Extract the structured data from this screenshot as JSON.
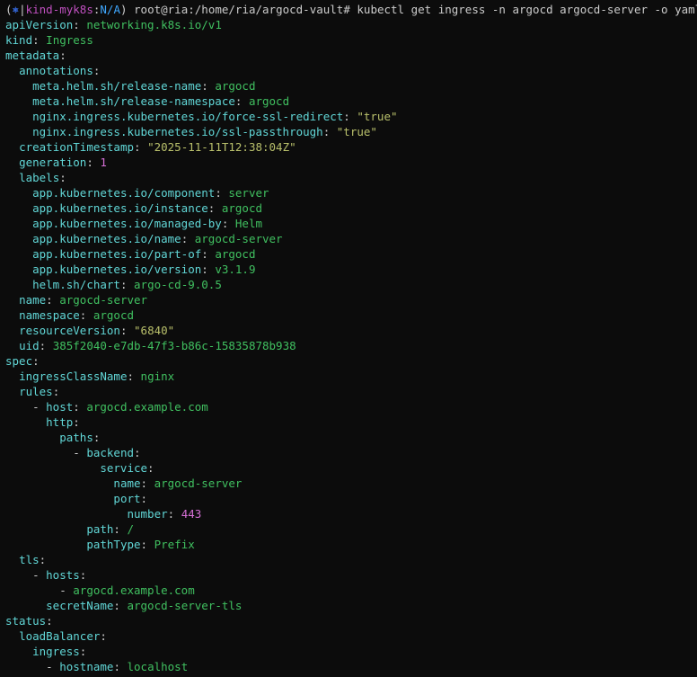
{
  "prompt": {
    "open_paren": "(",
    "k8s_symbol": "⎈",
    "separator": "|",
    "context": "kind-myk8s",
    "colon": ":",
    "namespace": "N/A",
    "close_paren": ")",
    "user_host_path": "root@ria:/home/ria/argocd-vault#",
    "command": "kubectl get ingress -n argocd argocd-server -o yaml | yq"
  },
  "lines": [
    {
      "indent": "",
      "key": "apiVersion",
      "sep": ": ",
      "value": "networking.k8s.io/v1",
      "type": "val"
    },
    {
      "indent": "",
      "key": "kind",
      "sep": ": ",
      "value": "Ingress",
      "type": "val"
    },
    {
      "indent": "",
      "key": "metadata",
      "sep": ":",
      "value": "",
      "type": "val"
    },
    {
      "indent": "  ",
      "key": "annotations",
      "sep": ":",
      "value": "",
      "type": "val"
    },
    {
      "indent": "    ",
      "key": "meta.helm.sh/release-name",
      "sep": ": ",
      "value": "argocd",
      "type": "val"
    },
    {
      "indent": "    ",
      "key": "meta.helm.sh/release-namespace",
      "sep": ": ",
      "value": "argocd",
      "type": "val"
    },
    {
      "indent": "    ",
      "key": "nginx.ingress.kubernetes.io/force-ssl-redirect",
      "sep": ": ",
      "value": "\"true\"",
      "type": "str"
    },
    {
      "indent": "    ",
      "key": "nginx.ingress.kubernetes.io/ssl-passthrough",
      "sep": ": ",
      "value": "\"true\"",
      "type": "str"
    },
    {
      "indent": "  ",
      "key": "creationTimestamp",
      "sep": ": ",
      "value": "\"2025-11-11T12:38:04Z\"",
      "type": "str"
    },
    {
      "indent": "  ",
      "key": "generation",
      "sep": ": ",
      "value": "1",
      "type": "num"
    },
    {
      "indent": "  ",
      "key": "labels",
      "sep": ":",
      "value": "",
      "type": "val"
    },
    {
      "indent": "    ",
      "key": "app.kubernetes.io/component",
      "sep": ": ",
      "value": "server",
      "type": "val"
    },
    {
      "indent": "    ",
      "key": "app.kubernetes.io/instance",
      "sep": ": ",
      "value": "argocd",
      "type": "val"
    },
    {
      "indent": "    ",
      "key": "app.kubernetes.io/managed-by",
      "sep": ": ",
      "value": "Helm",
      "type": "val"
    },
    {
      "indent": "    ",
      "key": "app.kubernetes.io/name",
      "sep": ": ",
      "value": "argocd-server",
      "type": "val"
    },
    {
      "indent": "    ",
      "key": "app.kubernetes.io/part-of",
      "sep": ": ",
      "value": "argocd",
      "type": "val"
    },
    {
      "indent": "    ",
      "key": "app.kubernetes.io/version",
      "sep": ": ",
      "value": "v3.1.9",
      "type": "val"
    },
    {
      "indent": "    ",
      "key": "helm.sh/chart",
      "sep": ": ",
      "value": "argo-cd-9.0.5",
      "type": "val"
    },
    {
      "indent": "  ",
      "key": "name",
      "sep": ": ",
      "value": "argocd-server",
      "type": "val"
    },
    {
      "indent": "  ",
      "key": "namespace",
      "sep": ": ",
      "value": "argocd",
      "type": "val"
    },
    {
      "indent": "  ",
      "key": "resourceVersion",
      "sep": ": ",
      "value": "\"6840\"",
      "type": "str"
    },
    {
      "indent": "  ",
      "key": "uid",
      "sep": ": ",
      "value": "385f2040-e7db-47f3-b86c-15835878b938",
      "type": "val"
    },
    {
      "indent": "",
      "key": "spec",
      "sep": ":",
      "value": "",
      "type": "val"
    },
    {
      "indent": "  ",
      "key": "ingressClassName",
      "sep": ": ",
      "value": "nginx",
      "type": "val"
    },
    {
      "indent": "  ",
      "key": "rules",
      "sep": ":",
      "value": "",
      "type": "val"
    },
    {
      "indent": "    - ",
      "key": "host",
      "sep": ": ",
      "value": "argocd.example.com",
      "type": "val"
    },
    {
      "indent": "      ",
      "key": "http",
      "sep": ":",
      "value": "",
      "type": "val"
    },
    {
      "indent": "        ",
      "key": "paths",
      "sep": ":",
      "value": "",
      "type": "val"
    },
    {
      "indent": "          - ",
      "key": "backend",
      "sep": ":",
      "value": "",
      "type": "val"
    },
    {
      "indent": "              ",
      "key": "service",
      "sep": ":",
      "value": "",
      "type": "val"
    },
    {
      "indent": "                ",
      "key": "name",
      "sep": ": ",
      "value": "argocd-server",
      "type": "val"
    },
    {
      "indent": "                ",
      "key": "port",
      "sep": ":",
      "value": "",
      "type": "val"
    },
    {
      "indent": "                  ",
      "key": "number",
      "sep": ": ",
      "value": "443",
      "type": "num"
    },
    {
      "indent": "            ",
      "key": "path",
      "sep": ": ",
      "value": "/",
      "type": "val"
    },
    {
      "indent": "            ",
      "key": "pathType",
      "sep": ": ",
      "value": "Prefix",
      "type": "val"
    },
    {
      "indent": "  ",
      "key": "tls",
      "sep": ":",
      "value": "",
      "type": "val"
    },
    {
      "indent": "    - ",
      "key": "hosts",
      "sep": ":",
      "value": "",
      "type": "val"
    },
    {
      "indent": "        - ",
      "key": "",
      "sep": "",
      "value": "argocd.example.com",
      "type": "val"
    },
    {
      "indent": "      ",
      "key": "secretName",
      "sep": ": ",
      "value": "argocd-server-tls",
      "type": "val"
    },
    {
      "indent": "",
      "key": "status",
      "sep": ":",
      "value": "",
      "type": "val"
    },
    {
      "indent": "  ",
      "key": "loadBalancer",
      "sep": ":",
      "value": "",
      "type": "val"
    },
    {
      "indent": "    ",
      "key": "ingress",
      "sep": ":",
      "value": "",
      "type": "val"
    },
    {
      "indent": "      - ",
      "key": "hostname",
      "sep": ": ",
      "value": "localhost",
      "type": "val"
    }
  ],
  "colors": {
    "background": "#0c0c0c",
    "key": "#61d6d6",
    "value": "#40c060",
    "string": "#b9c06b",
    "number": "#d670d6"
  }
}
